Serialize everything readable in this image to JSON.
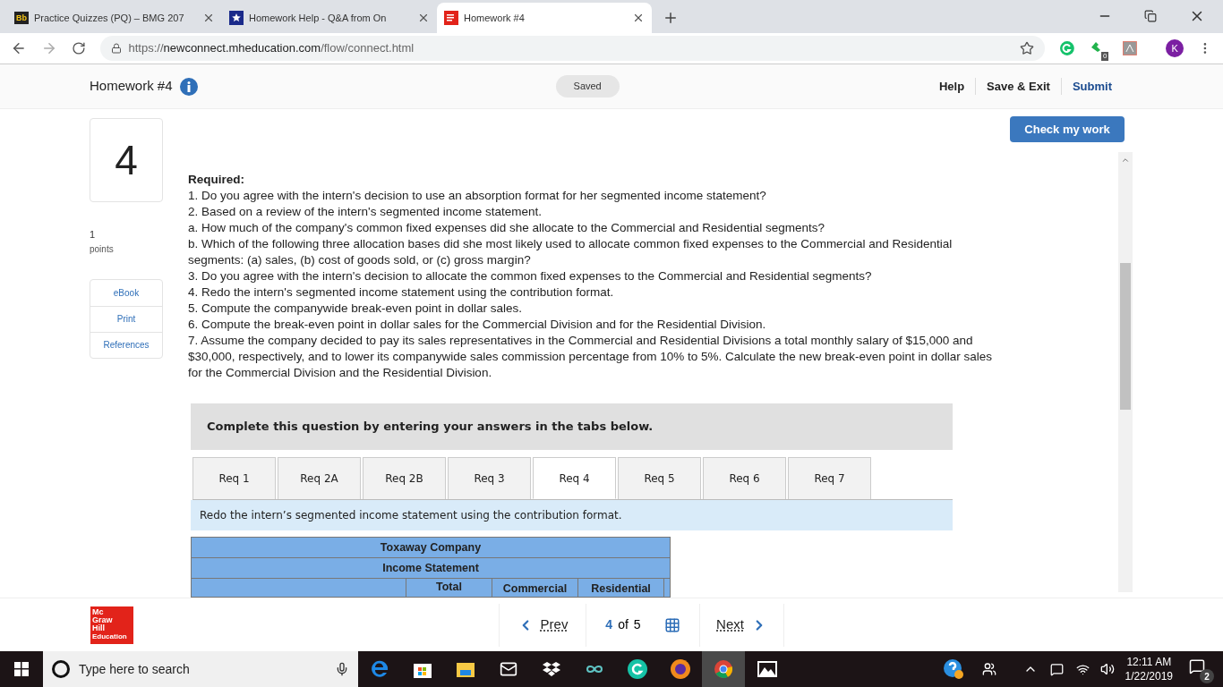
{
  "browser": {
    "tabs": [
      {
        "title": "Practice Quizzes (PQ) – BMG 207",
        "icon": "Bb",
        "selected": false
      },
      {
        "title": "Homework Help - Q&A from On",
        "selected": false
      },
      {
        "title": "Homework #4",
        "selected": true
      }
    ],
    "url": {
      "scheme": "https://",
      "host": "newconnect.mheducation.com",
      "path": "/flow/connect.html"
    },
    "extension_badge": "0",
    "avatar": "K"
  },
  "app_header": {
    "title": "Homework #4",
    "saved_badge": "Saved",
    "actions": [
      {
        "label": "Help",
        "kind": "link"
      },
      {
        "label": "Save & Exit",
        "kind": "link"
      },
      {
        "label": "Submit",
        "kind": "primary"
      }
    ]
  },
  "question": {
    "number": "4",
    "points_value": "1",
    "points_label": "points",
    "side_links": [
      "eBook",
      "Print",
      "References"
    ],
    "check_button": "Check my work",
    "required_heading": "Required:",
    "lines": [
      "1. Do you agree with the intern's decision to use an absorption format for her segmented income statement?",
      "2. Based on a review of the intern's segmented income statement.",
      "a. How much of the company's common fixed expenses did she allocate to the Commercial and Residential segments?",
      "b. Which of the following three allocation bases did she most likely used to allocate common fixed expenses to the Commercial and Residential segments: (a) sales, (b) cost of goods sold, or (c) gross margin?",
      "3. Do you agree with the intern's decision to allocate the common fixed expenses to the Commercial and Residential segments?",
      "4. Redo the intern's segmented income statement using the contribution format.",
      "5. Compute the companywide break-even point in dollar sales.",
      "6. Compute the break-even point in dollar sales for the Commercial Division and for the Residential Division.",
      "7. Assume the company decided to pay its sales representatives in the Commercial and Residential Divisions a total monthly salary of $15,000 and $30,000, respectively, and to lower its companywide sales commission percentage from 10% to 5%. Calculate the new break-even point in dollar sales for the Commercial Division and the Residential Division."
    ]
  },
  "answer_section": {
    "instructions": "Complete this question by entering your answers in the tabs below.",
    "tabs": [
      {
        "label": "Req 1",
        "selected": false
      },
      {
        "label": "Req 2A",
        "selected": false
      },
      {
        "label": "Req 2B",
        "selected": false
      },
      {
        "label": "Req 3",
        "selected": false
      },
      {
        "label": "Req 4",
        "selected": true
      },
      {
        "label": "Req 5",
        "selected": false
      },
      {
        "label": "Req 6",
        "selected": false
      },
      {
        "label": "Req 7",
        "selected": false
      }
    ],
    "tab_instruction": "Redo the intern’s segmented income statement using the contribution format.",
    "table": {
      "title_rows": [
        "Toxaway Company",
        "Income Statement"
      ],
      "columns": [
        "Total",
        "Commercial",
        "Residential"
      ]
    }
  },
  "footer": {
    "logo_lines": [
      "Mc",
      "Graw",
      "Hill",
      "Education"
    ],
    "prev": "Prev",
    "page_current": "4",
    "page_of": "of",
    "page_total": "5",
    "next": "Next"
  },
  "taskbar": {
    "search_placeholder": "Type here to search",
    "time": "12:11 AM",
    "date": "1/22/2019",
    "notification_count": "2"
  }
}
